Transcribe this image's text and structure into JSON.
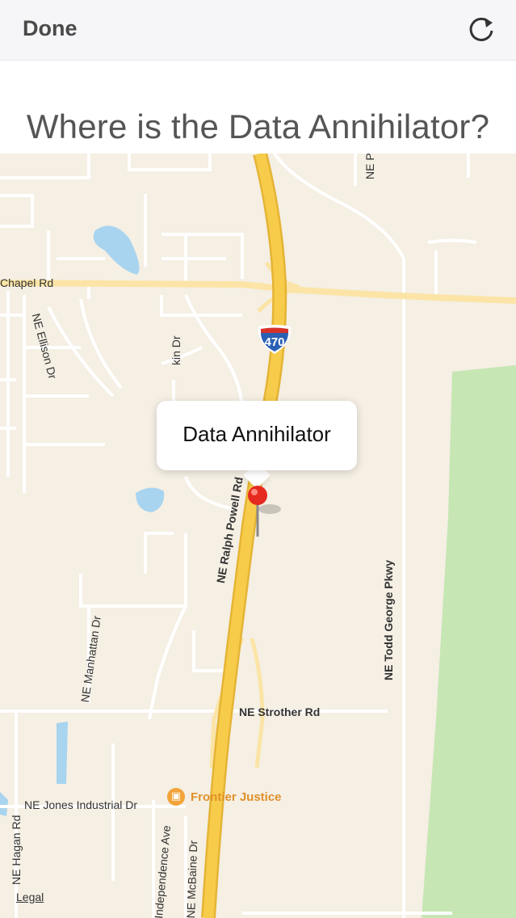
{
  "navbar": {
    "done_label": "Done",
    "refresh_icon": "refresh-icon"
  },
  "question": {
    "text": "Where is the Data Annihilator?"
  },
  "map": {
    "callout_title": "Data Annihilator",
    "highway_shield": "470",
    "poi_label": "Frontier Justice",
    "poi_icon": "briefcase-icon",
    "legal_label": "Legal",
    "streets": {
      "chapel": "Chapel Rd",
      "ellison": "NE Ellison Dr",
      "ralph_powell": "NE Ralph Powell Rd",
      "todd_george": "NE Todd George Pkwy",
      "manhattan": "NE Manhattan Dr",
      "strother": "NE Strother Rd",
      "jones_industrial": "NE Jones Industrial Dr",
      "hagan": "NE Hagan Rd",
      "independence": "Independence Ave",
      "mcbaine": "NE McBaine Dr",
      "tompkin": "kin Dr",
      "ne_p": "NE P"
    },
    "colors": {
      "land": "#f5efe4",
      "park": "#c6e6b4",
      "water": "#a8d4ef",
      "highway": "#f7cc4a",
      "arterial": "#fbe4a6",
      "pin": "#e52a1f"
    }
  }
}
